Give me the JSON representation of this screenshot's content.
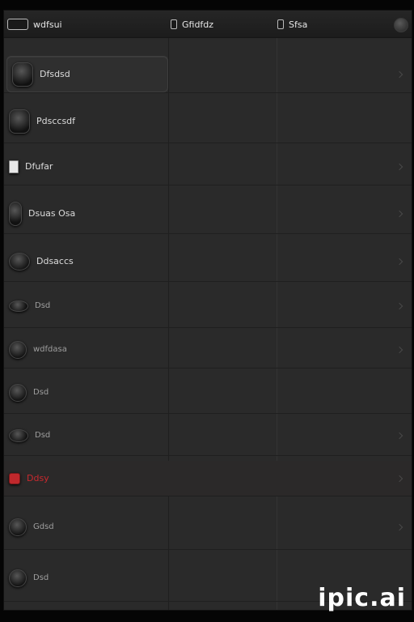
{
  "header": {
    "col1_label": "wdfsui",
    "col2_label": "Gfidfdz",
    "col3_label": "Sfsa",
    "icons": [
      "toggle-icon",
      "window-icon",
      "panel-icon",
      "settings-icon"
    ]
  },
  "sidebar": {
    "items": [
      {
        "label": "Dfsdsd",
        "icon": "circle-button-icon",
        "selected": true
      },
      {
        "label": "Pdsccsdf",
        "icon": "phone-icon"
      },
      {
        "label": "Dfufar",
        "icon": "document-icon"
      },
      {
        "label": "Dsuas Osa",
        "icon": "tablet-icon"
      },
      {
        "label": "Ddsaccs",
        "icon": "camera-icon"
      },
      {
        "label": "Dsd",
        "icon": "eye-icon"
      },
      {
        "label": "wdfdasa",
        "icon": "bell-icon"
      },
      {
        "label": "Dsd",
        "icon": "clock-icon"
      },
      {
        "label": "Dsd",
        "icon": "lens-icon"
      },
      {
        "label": "Ddsy",
        "icon": "alert-icon",
        "danger": true,
        "accent": "#c9292e"
      },
      {
        "label": "Gdsd",
        "icon": "globe-icon"
      },
      {
        "label": "Dsd",
        "icon": "disc-icon"
      }
    ]
  },
  "watermark": "ipic.ai"
}
